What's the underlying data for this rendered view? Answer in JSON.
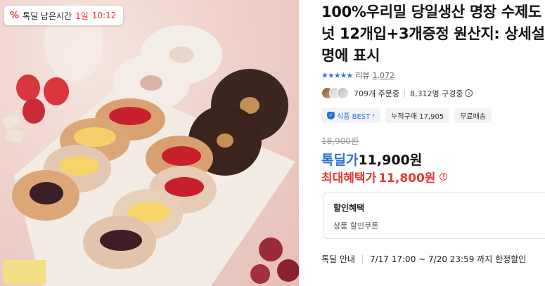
{
  "deal_timer": {
    "icon": "percent-icon",
    "label": "톡딜 남은시간",
    "days": "1일",
    "time": "10:12"
  },
  "product": {
    "title": "100%우리밀 당일생산 명장 수제도넛 12개입+3개증정 원산지: 상세설명에 표시",
    "rating_stars": 5,
    "review_label": "리뷰",
    "review_count": "1,072",
    "orders": "709개 주문중",
    "subscribers": "8,312명 구경중",
    "badges": {
      "best": "식품 BEST",
      "cumulative": "누적구매 17,905",
      "shipping": "무료배송"
    },
    "original_price": "18,900원",
    "deal_price_label": "톡딜가",
    "deal_price": "11,900원",
    "max_benefit_label": "최대혜택가",
    "max_benefit_price": "11,800원"
  },
  "discount": {
    "title": "할인혜택",
    "item": "상품 할인쿠폰"
  },
  "notice": {
    "label": "톡딜 안내",
    "period": "7/17 17:00 ~ 7/20 23:59 까지 한정할인"
  },
  "colors": {
    "accent_blue": "#2f6fd6",
    "accent_red": "#e53935",
    "star_blue": "#3d6fe0"
  }
}
